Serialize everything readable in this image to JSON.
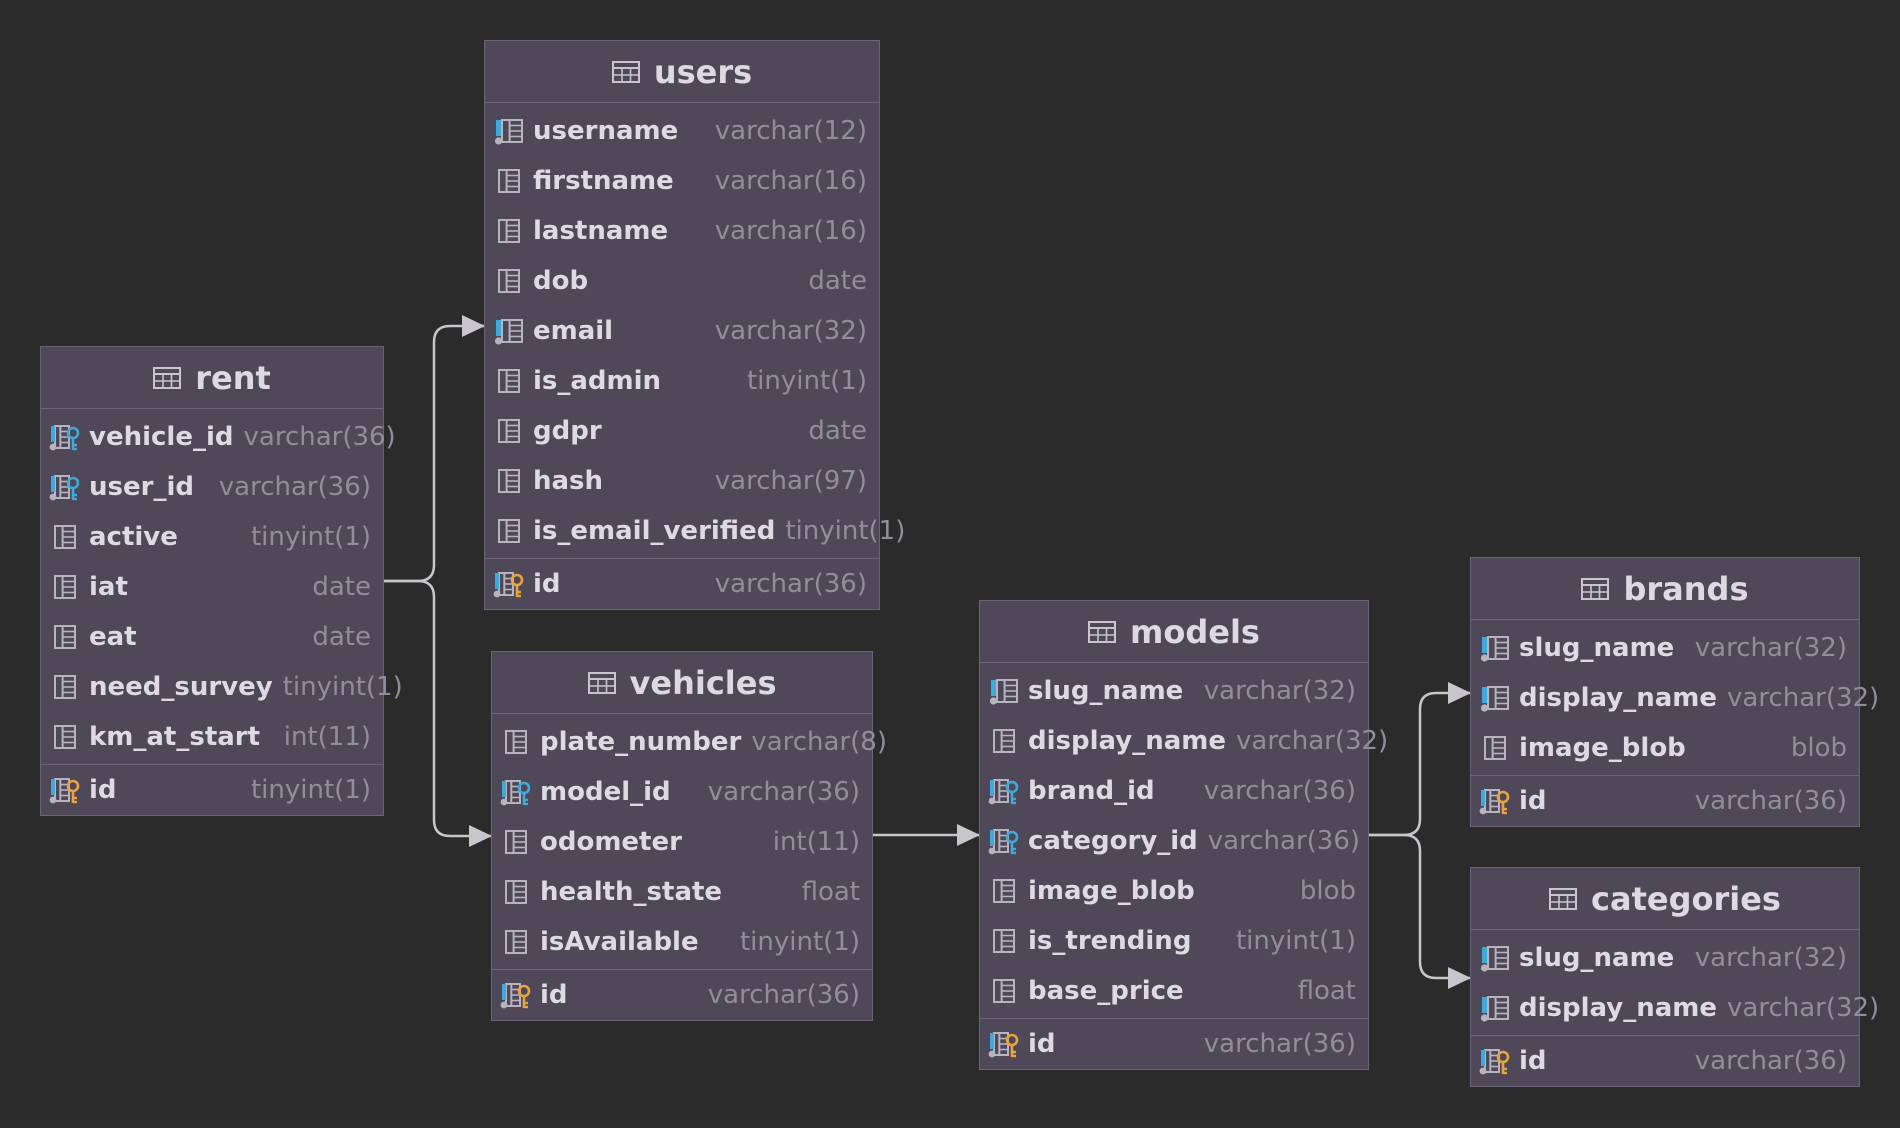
{
  "colors": {
    "background": "#2b2b2b",
    "table_fill": "#4f4858",
    "table_border": "#6a6475",
    "column_type": "#928d9b",
    "fk_key": "#3fa9d9",
    "pk_key": "#e8a33d",
    "connector": "#c8c6cc"
  },
  "tables": [
    {
      "id": "rent",
      "title": "rent",
      "columns": [
        {
          "name": "vehicle_id",
          "type": "varchar(36)",
          "icon": "foreign-key-icon"
        },
        {
          "name": "user_id",
          "type": "varchar(36)",
          "icon": "foreign-key-icon"
        },
        {
          "name": "active",
          "type": "tinyint(1)",
          "icon": "column-icon"
        },
        {
          "name": "iat",
          "type": "date",
          "icon": "column-icon"
        },
        {
          "name": "eat",
          "type": "date",
          "icon": "column-icon"
        },
        {
          "name": "need_survey",
          "type": "tinyint(1)",
          "icon": "column-icon"
        },
        {
          "name": "km_at_start",
          "type": "int(11)",
          "icon": "column-icon"
        }
      ],
      "primary": {
        "name": "id",
        "type": "tinyint(1)",
        "icon": "primary-key-icon"
      }
    },
    {
      "id": "users",
      "title": "users",
      "columns": [
        {
          "name": "username",
          "type": "varchar(12)",
          "icon": "indexed-column-icon"
        },
        {
          "name": "firstname",
          "type": "varchar(16)",
          "icon": "column-icon"
        },
        {
          "name": "lastname",
          "type": "varchar(16)",
          "icon": "column-icon"
        },
        {
          "name": "dob",
          "type": "date",
          "icon": "column-icon"
        },
        {
          "name": "email",
          "type": "varchar(32)",
          "icon": "indexed-column-icon"
        },
        {
          "name": "is_admin",
          "type": "tinyint(1)",
          "icon": "column-icon"
        },
        {
          "name": "gdpr",
          "type": "date",
          "icon": "column-icon"
        },
        {
          "name": "hash",
          "type": "varchar(97)",
          "icon": "column-icon"
        },
        {
          "name": "is_email_verified",
          "type": "tinyint(1)",
          "icon": "column-icon"
        }
      ],
      "primary": {
        "name": "id",
        "type": "varchar(36)",
        "icon": "primary-key-icon"
      }
    },
    {
      "id": "vehicles",
      "title": "vehicles",
      "columns": [
        {
          "name": "plate_number",
          "type": "varchar(8)",
          "icon": "column-icon"
        },
        {
          "name": "model_id",
          "type": "varchar(36)",
          "icon": "foreign-key-icon"
        },
        {
          "name": "odometer",
          "type": "int(11)",
          "icon": "column-icon"
        },
        {
          "name": "health_state",
          "type": "float",
          "icon": "column-icon"
        },
        {
          "name": "isAvailable",
          "type": "tinyint(1)",
          "icon": "column-icon"
        }
      ],
      "primary": {
        "name": "id",
        "type": "varchar(36)",
        "icon": "primary-key-icon"
      }
    },
    {
      "id": "models",
      "title": "models",
      "columns": [
        {
          "name": "slug_name",
          "type": "varchar(32)",
          "icon": "indexed-column-icon"
        },
        {
          "name": "display_name",
          "type": "varchar(32)",
          "icon": "column-icon"
        },
        {
          "name": "brand_id",
          "type": "varchar(36)",
          "icon": "foreign-key-icon"
        },
        {
          "name": "category_id",
          "type": "varchar(36)",
          "icon": "foreign-key-icon"
        },
        {
          "name": "image_blob",
          "type": "blob",
          "icon": "column-icon"
        },
        {
          "name": "is_trending",
          "type": "tinyint(1)",
          "icon": "column-icon"
        },
        {
          "name": "base_price",
          "type": "float",
          "icon": "column-icon"
        }
      ],
      "primary": {
        "name": "id",
        "type": "varchar(36)",
        "icon": "primary-key-icon"
      }
    },
    {
      "id": "brands",
      "title": "brands",
      "columns": [
        {
          "name": "slug_name",
          "type": "varchar(32)",
          "icon": "indexed-column-icon"
        },
        {
          "name": "display_name",
          "type": "varchar(32)",
          "icon": "indexed-column-icon"
        },
        {
          "name": "image_blob",
          "type": "blob",
          "icon": "column-icon"
        }
      ],
      "primary": {
        "name": "id",
        "type": "varchar(36)",
        "icon": "primary-key-icon"
      }
    },
    {
      "id": "categories",
      "title": "categories",
      "columns": [
        {
          "name": "slug_name",
          "type": "varchar(32)",
          "icon": "indexed-column-icon"
        },
        {
          "name": "display_name",
          "type": "varchar(32)",
          "icon": "indexed-column-icon"
        }
      ],
      "primary": {
        "name": "id",
        "type": "varchar(36)",
        "icon": "primary-key-icon"
      }
    }
  ],
  "relations": [
    {
      "from": "rent",
      "to": "users"
    },
    {
      "from": "rent",
      "to": "vehicles"
    },
    {
      "from": "vehicles",
      "to": "models"
    },
    {
      "from": "models",
      "to": "brands"
    },
    {
      "from": "models",
      "to": "categories"
    }
  ]
}
